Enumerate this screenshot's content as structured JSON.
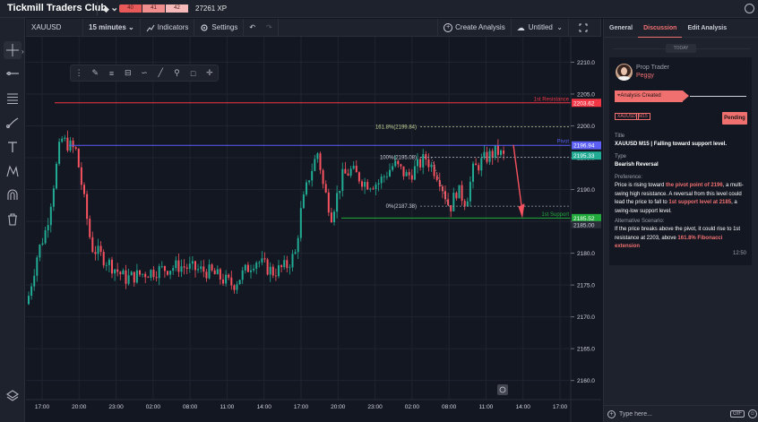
{
  "app": {
    "title": "Tickmill Traders Club",
    "xp_levels": [
      "40",
      "41",
      "42"
    ],
    "xp": "27261 XP"
  },
  "toolbar": {
    "symbol": "XAUUSD",
    "interval": "15 minutes",
    "indicators_label": "Indicators",
    "settings_label": "Settings",
    "create_label": "Create Analysis",
    "untitled_label": "Untitled"
  },
  "left_tools": [
    "crosshair",
    "horizontal-line",
    "fib-retracement",
    "brush",
    "text",
    "pattern",
    "magnet",
    "trash",
    "layers"
  ],
  "chart_data": {
    "type": "candlestick",
    "symbol": "XAUUSD",
    "interval": "15 minutes",
    "y_range": [
      2157,
      2214
    ],
    "y_ticks": [
      2210,
      2205,
      2200,
      2195,
      2190,
      2185,
      2180,
      2175,
      2170,
      2165,
      2160
    ],
    "x_ticks": [
      "17:00",
      "20:00",
      "23:00",
      "02:00",
      "08:00",
      "11:00",
      "14:00",
      "17:00",
      "20:00",
      "23:00",
      "02:00",
      "08:00",
      "11:00",
      "14:00",
      "17:00"
    ],
    "grid": true,
    "levels": [
      {
        "label": "1st Resistance",
        "value": 2203.62,
        "tag": "2203.62",
        "color": "#f23645"
      },
      {
        "label": "Pivot",
        "value": 2196.94,
        "tag": "2196.94",
        "color": "#5b5ff5"
      },
      {
        "label": "1st Support",
        "value": 2185.52,
        "tag": "2185.52",
        "color": "#22ab3c"
      }
    ],
    "fib": [
      {
        "label": "161.8%(2199.84)",
        "value": 2199.84
      },
      {
        "label": "100%(2195.08)",
        "value": 2195.08
      },
      {
        "label": "0%(2187.38)",
        "value": 2187.38
      }
    ],
    "last_price_tag": "2195.33",
    "last_price": 2195.33,
    "support_price_tag": "2185.00"
  },
  "panel": {
    "tabs": [
      "General",
      "Discussion",
      "Edit Analysis"
    ],
    "active_tab": "Discussion",
    "today": "TODAY",
    "role": "Prop Trader",
    "user": "Peggy",
    "created": "Analysis Created",
    "chips": [
      "XAUUSD",
      "M15"
    ],
    "status": "Pending",
    "title_label": "Title",
    "title": "XAUUSD M15 | Falling toward support level.",
    "type_label": "Type",
    "type": "Bearish Reversal",
    "pref_label": "Preference:",
    "pref_1": "Price is rising toward ",
    "pref_hl1": "the pivot point of 2196",
    "pref_2": ", a multi-swing high resistance. A reversal from this level could lead the price to fall to ",
    "pref_hl2": "1st support level at 2185",
    "pref_3": ", a swing-low support level.",
    "alt_label": "Alternative Scenario:",
    "alt_1": "If the price breaks above the pivot, it could rise to 1st resistance at 2203, above ",
    "alt_hl": "161.8% Fibonacci extension",
    "time": "12:50",
    "input_placeholder": "Type here...",
    "gif": "GIF"
  }
}
